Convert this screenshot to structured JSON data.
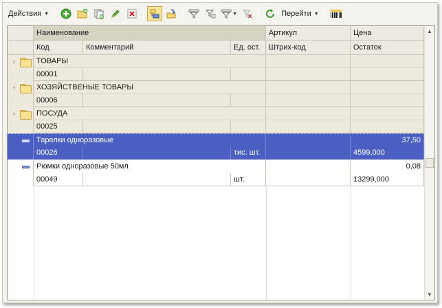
{
  "toolbar": {
    "actions_label": "Действия",
    "goto_label": "Перейти",
    "buttons": [
      {
        "icon": "add-icon"
      },
      {
        "icon": "add-folder-icon"
      },
      {
        "icon": "copy-icon"
      },
      {
        "icon": "edit-icon"
      },
      {
        "icon": "delete-icon"
      },
      {
        "icon": "hierarchy-icon"
      },
      {
        "icon": "move-to-folder-icon"
      },
      {
        "icon": "filter-icon"
      },
      {
        "icon": "filter-by-value-icon"
      },
      {
        "icon": "filter-list-icon"
      },
      {
        "icon": "clear-filter-icon"
      },
      {
        "icon": "refresh-icon"
      },
      {
        "icon": "barcode-icon"
      }
    ]
  },
  "columns": {
    "name": "Наименование",
    "article": "Артикул",
    "price": "Цена",
    "code": "Код",
    "comment": "Комментарий",
    "unit": "Ед. ост.",
    "barcode": "Штрих-код",
    "balance": "Остаток"
  },
  "rows": [
    {
      "type": "group",
      "name": "ТОВАРЫ",
      "code": "00001",
      "comment": "",
      "unit": "",
      "article": "",
      "barcode": "",
      "price": "",
      "balance": ""
    },
    {
      "type": "group",
      "name": "ХОЗЯЙСТВЕНЫЕ ТОВАРЫ",
      "code": "00006",
      "comment": "",
      "unit": "",
      "article": "",
      "barcode": "",
      "price": "",
      "balance": ""
    },
    {
      "type": "group",
      "name": "ПОСУДА",
      "code": "00025",
      "comment": "",
      "unit": "",
      "article": "",
      "barcode": "",
      "price": "",
      "balance": ""
    },
    {
      "type": "item",
      "selected": true,
      "name": "Тарелки одноразовые",
      "code": "00026",
      "comment": "",
      "unit": "тис. шт.",
      "article": "",
      "barcode": "",
      "price": "37,50",
      "balance": "4599,000"
    },
    {
      "type": "item",
      "selected": false,
      "name": "Рюмки одноразовые 50мл",
      "code": "00049",
      "comment": "",
      "unit": "шт.",
      "article": "",
      "barcode": "",
      "price": "0,08",
      "balance": "13299,000"
    }
  ],
  "colors": {
    "selection": "#4b5fc3",
    "group_bg": "#ede9dc",
    "header_bg": "#eceae1"
  }
}
